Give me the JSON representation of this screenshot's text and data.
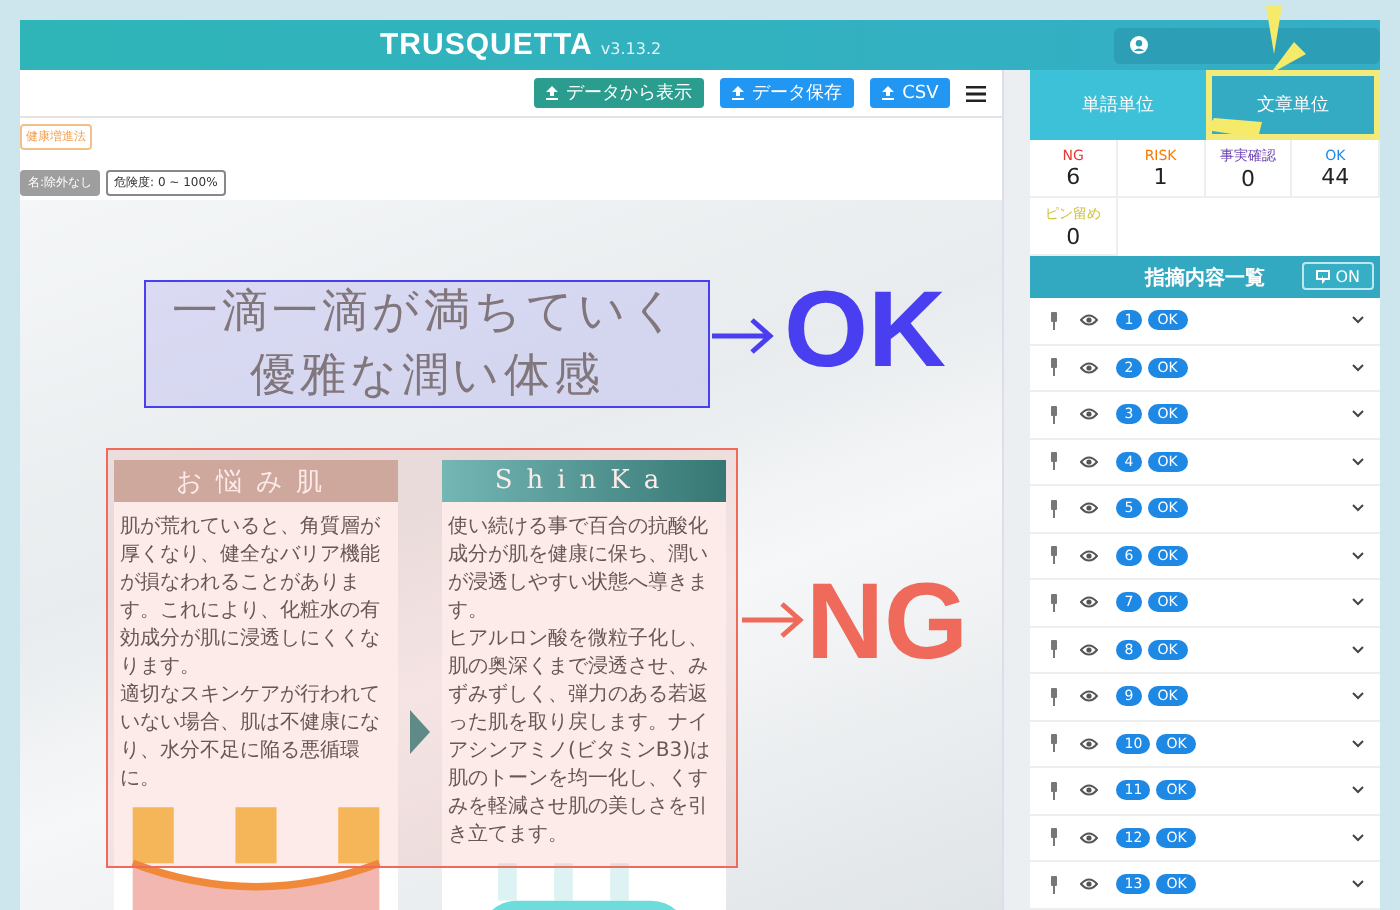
{
  "header": {
    "logo": "TRUSQUETTA",
    "version": "v3.13.2"
  },
  "toolbar": {
    "buttons": [
      {
        "label": "データから表示",
        "kind": "primary"
      },
      {
        "label": "データ保存",
        "kind": "secondary"
      },
      {
        "label": "CSV",
        "kind": "secondary"
      }
    ]
  },
  "filters": {
    "law_tag": "健康増進法",
    "tags": [
      {
        "label": "名:除外なし",
        "kind": "filled"
      },
      {
        "label": "危険度: 0 ~ 100%",
        "kind": "outline"
      }
    ]
  },
  "document": {
    "headline": [
      "一滴一滴が満ちていく",
      "優雅な潤い体感"
    ],
    "cards": [
      {
        "title": "お悩み肌",
        "kind": "problem",
        "paragraphs": [
          "肌が荒れていると、角質層が厚くなり、健全なバリア機能が損なわれることがあります。これにより、化粧水の有効成分が肌に浸透しにくくなります。",
          "適切なスキンケアが行われていない場合、肌は不健康になり、水分不足に陥る悪循環に。"
        ]
      },
      {
        "title": "ShinKa",
        "kind": "solution",
        "paragraphs": [
          "使い続ける事で百合の抗酸化成分が肌を健康に保ち、潤いが浸透しやすい状態へ導きます。",
          "ヒアルロン酸を微粒子化し、肌の奥深くまで浸透させ、みずみずしく、弾力のある若返った肌を取り戻します。ナイアシンアミノ(ビタミンB3)は肌のトーンを均一化し、くすみを軽減させ肌の美しさを引き立てます。"
        ]
      }
    ]
  },
  "annotations": [
    {
      "label": "OK",
      "color": "#4a3ff0"
    },
    {
      "label": "NG",
      "color": "#f06a5c"
    }
  ],
  "side_panel": {
    "tabs": [
      {
        "label": "単語単位",
        "selected": false
      },
      {
        "label": "文章単位",
        "selected": true
      }
    ],
    "stats": [
      {
        "label": "NG",
        "value": "6",
        "color": "#e53935"
      },
      {
        "label": "RISK",
        "value": "1",
        "color": "#f57c00"
      },
      {
        "label": "事実確認",
        "value": "0",
        "color": "#6a3fb5"
      },
      {
        "label": "OK",
        "value": "44",
        "color": "#1e88e5"
      },
      {
        "label": "ピン留め",
        "value": "0",
        "color": "#cfc23a"
      }
    ],
    "list_title": "指摘内容一覧",
    "toggle": {
      "label": "ON",
      "on": true
    },
    "items": [
      {
        "number": "1",
        "verdict": "OK"
      },
      {
        "number": "2",
        "verdict": "OK"
      },
      {
        "number": "3",
        "verdict": "OK"
      },
      {
        "number": "4",
        "verdict": "OK"
      },
      {
        "number": "5",
        "verdict": "OK"
      },
      {
        "number": "6",
        "verdict": "OK"
      },
      {
        "number": "7",
        "verdict": "OK"
      },
      {
        "number": "8",
        "verdict": "OK"
      },
      {
        "number": "9",
        "verdict": "OK"
      },
      {
        "number": "10",
        "verdict": "OK"
      },
      {
        "number": "11",
        "verdict": "OK"
      },
      {
        "number": "12",
        "verdict": "OK"
      },
      {
        "number": "13",
        "verdict": "OK"
      }
    ]
  }
}
